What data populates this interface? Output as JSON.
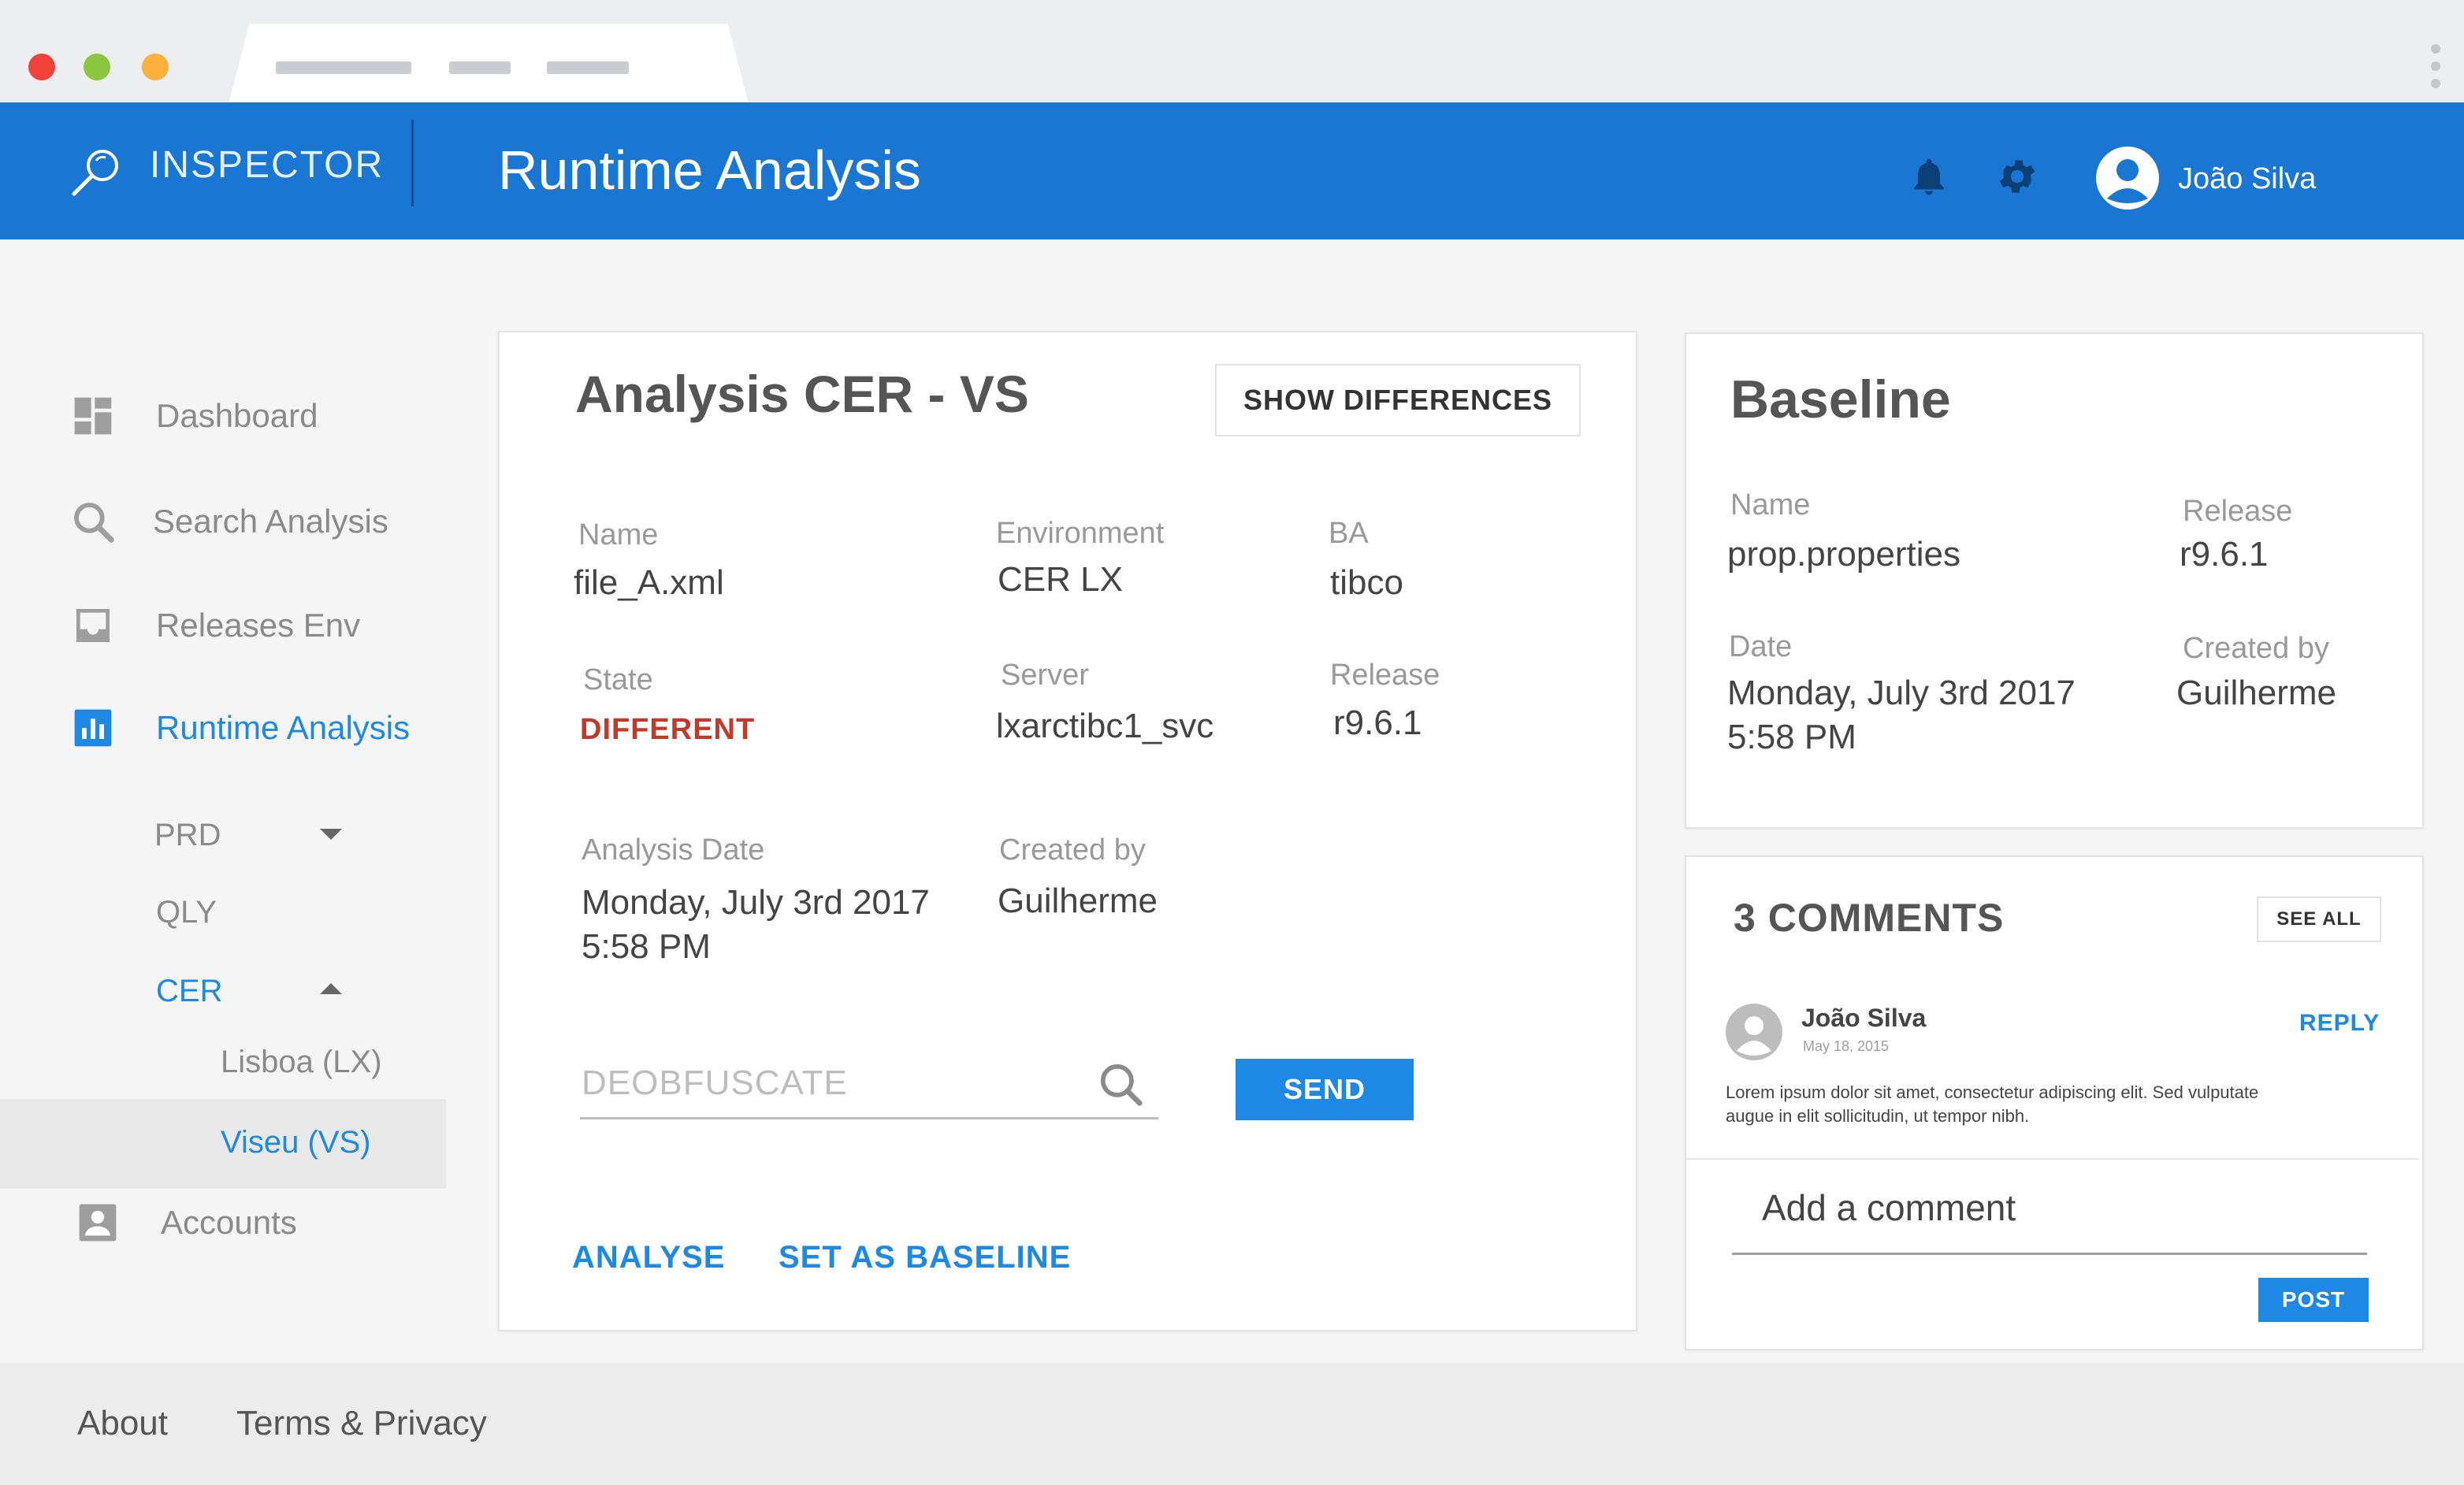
{
  "header": {
    "brand": "INSPECTOR",
    "title": "Runtime Analysis",
    "user_name": "João Silva",
    "color": "#1976d2"
  },
  "sidebar": {
    "items": [
      {
        "label": "Dashboard",
        "icon": "dashboard-icon"
      },
      {
        "label": "Search Analysis",
        "icon": "search-icon"
      },
      {
        "label": "Releases Env",
        "icon": "inbox-icon"
      },
      {
        "label": "Runtime Analysis",
        "icon": "bar-chart-icon",
        "active": true
      }
    ],
    "environments": [
      "PRD",
      "QLY",
      "CER"
    ],
    "cer_children": [
      "Lisboa (LX)",
      "Viseu (VS)"
    ],
    "accounts": "Accounts"
  },
  "analysis": {
    "title": "Analysis CER - VS",
    "show_diff_label": "SHOW DIFFERENCES",
    "fields": {
      "name_label": "Name",
      "name_value": "file_A.xml",
      "env_label": "Environment",
      "env_value": "CER LX",
      "ba_label": "BA",
      "ba_value": "tibco",
      "state_label": "State",
      "state_value": "DIFFERENT",
      "server_label": "Server",
      "server_value": "lxarctibc1_svc",
      "release_label": "Release",
      "release_value": "r9.6.1",
      "date_label": "Analysis Date",
      "date_value_1": "Monday, July 3rd 2017",
      "date_value_2": "5:58 PM",
      "created_label": "Created by",
      "created_value": "Guilherme"
    },
    "deobfuscate_placeholder": "DEOBFUSCATE",
    "send_label": "SEND",
    "analyse_label": "ANALYSE",
    "baseline_label": "SET AS BASELINE",
    "state_color": "#c0392b"
  },
  "baseline": {
    "title": "Baseline",
    "name_label": "Name",
    "name_value": "prop.properties",
    "release_label": "Release",
    "release_value": "r9.6.1",
    "date_label": "Date",
    "date_value_1": "Monday, July 3rd 2017",
    "date_value_2": "5:58 PM",
    "created_label": "Created by",
    "created_value": "Guilherme"
  },
  "comments": {
    "title": "3 COMMENTS",
    "see_all": "SEE ALL",
    "author": "João Silva",
    "date": "May 18, 2015",
    "reply": "REPLY",
    "text_1": "Lorem ipsum dolor sit amet, consectetur adipiscing elit. Sed vulputate",
    "text_2": "augue in elit sollicitudin, ut tempor nibh.",
    "add_placeholder": "Add a comment",
    "post": "POST"
  },
  "footer": {
    "about": "About",
    "terms": "Terms & Privacy"
  }
}
